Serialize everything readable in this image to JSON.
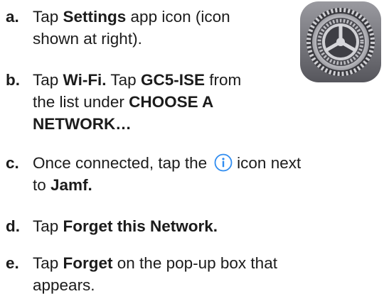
{
  "colors": {
    "text": "#1b1b1b",
    "info_icon": "#2f8cf0",
    "settings_bg_top": "#8d8d93",
    "settings_bg_bottom": "#5a5a60"
  },
  "steps": {
    "a": {
      "marker": "a.",
      "t1": "Tap ",
      "b1": "Settings",
      "t2": " app icon (icon",
      "line2": "shown at right)."
    },
    "b": {
      "marker": "b.",
      "t1": "Tap ",
      "b1": "Wi-Fi.",
      "t2": " Tap ",
      "b2": "GC5-ISE",
      "t3": " from",
      "line2": "the list under ",
      "b3": "CHOOSE A",
      "b4": "NETWORK…"
    },
    "c": {
      "marker": "c.",
      "t1": "Once connected, tap the",
      "t2": "icon next",
      "line2": "to ",
      "b1": "Jamf."
    },
    "d": {
      "marker": "d.",
      "t1": "Tap ",
      "b1": "Forget this Network."
    },
    "e": {
      "marker": "e.",
      "t1": "Tap ",
      "b1": "Forget",
      "t2": " on the pop-up box that",
      "line2": "appears."
    }
  },
  "icons": {
    "settings": "settings-gear-icon",
    "info": "info-circle-icon"
  }
}
